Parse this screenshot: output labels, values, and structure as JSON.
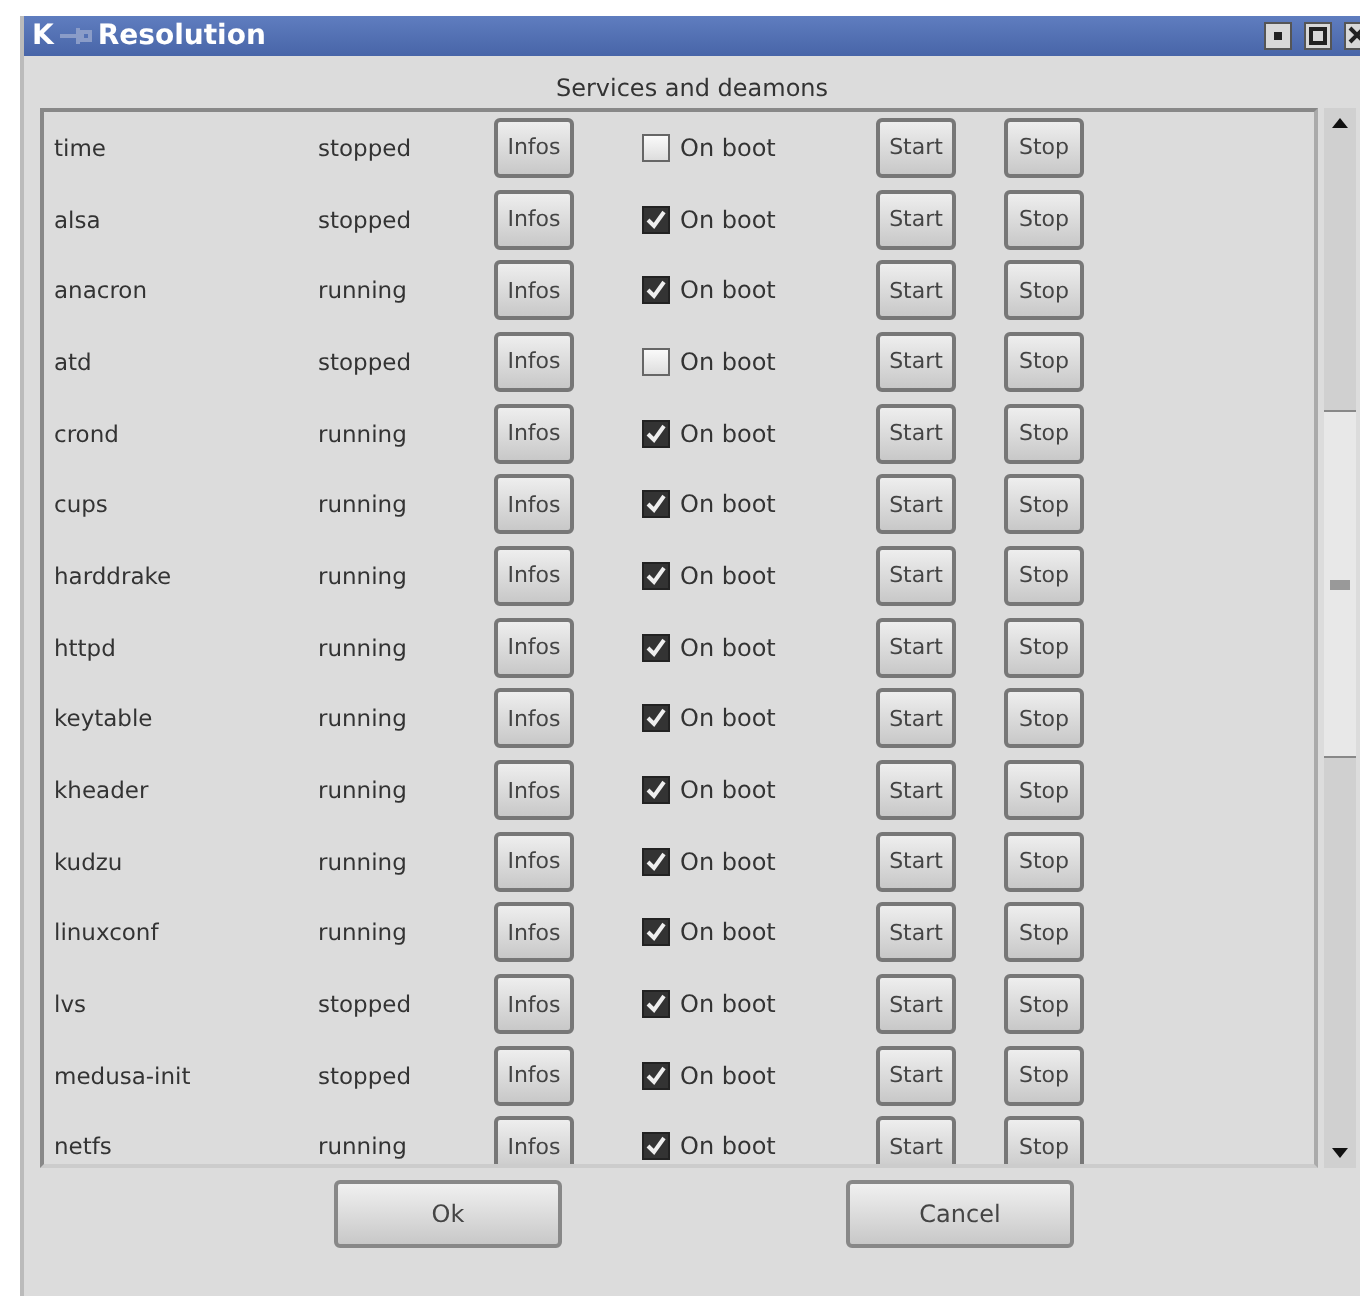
{
  "window": {
    "logo": "K",
    "title": "Resolution"
  },
  "heading": "Services and deamons",
  "services": [
    {
      "name": "time",
      "status": "stopped",
      "info": "Infos",
      "on_boot": false,
      "boot_label": "On boot",
      "start": "Start",
      "stop": "Stop"
    },
    {
      "name": "alsa",
      "status": "stopped",
      "info": "Infos",
      "on_boot": true,
      "boot_label": "On boot",
      "start": "Start",
      "stop": "Stop"
    },
    {
      "name": "anacron",
      "status": "running",
      "info": "Infos",
      "on_boot": true,
      "boot_label": "On boot",
      "start": "Start",
      "stop": "Stop"
    },
    {
      "name": "atd",
      "status": "stopped",
      "info": "Infos",
      "on_boot": false,
      "boot_label": "On boot",
      "start": "Start",
      "stop": "Stop"
    },
    {
      "name": "crond",
      "status": "running",
      "info": "Infos",
      "on_boot": true,
      "boot_label": "On boot",
      "start": "Start",
      "stop": "Stop"
    },
    {
      "name": "cups",
      "status": "running",
      "info": "Infos",
      "on_boot": true,
      "boot_label": "On boot",
      "start": "Start",
      "stop": "Stop"
    },
    {
      "name": "harddrake",
      "status": "running",
      "info": "Infos",
      "on_boot": true,
      "boot_label": "On boot",
      "start": "Start",
      "stop": "Stop"
    },
    {
      "name": "httpd",
      "status": "running",
      "info": "Infos",
      "on_boot": true,
      "boot_label": "On boot",
      "start": "Start",
      "stop": "Stop"
    },
    {
      "name": "keytable",
      "status": "running",
      "info": "Infos",
      "on_boot": true,
      "boot_label": "On boot",
      "start": "Start",
      "stop": "Stop"
    },
    {
      "name": "kheader",
      "status": "running",
      "info": "Infos",
      "on_boot": true,
      "boot_label": "On boot",
      "start": "Start",
      "stop": "Stop"
    },
    {
      "name": "kudzu",
      "status": "running",
      "info": "Infos",
      "on_boot": true,
      "boot_label": "On boot",
      "start": "Start",
      "stop": "Stop"
    },
    {
      "name": "linuxconf",
      "status": "running",
      "info": "Infos",
      "on_boot": true,
      "boot_label": "On boot",
      "start": "Start",
      "stop": "Stop"
    },
    {
      "name": "lvs",
      "status": "stopped",
      "info": "Infos",
      "on_boot": true,
      "boot_label": "On boot",
      "start": "Start",
      "stop": "Stop"
    },
    {
      "name": "medusa-init",
      "status": "stopped",
      "info": "Infos",
      "on_boot": true,
      "boot_label": "On boot",
      "start": "Start",
      "stop": "Stop"
    },
    {
      "name": "netfs",
      "status": "running",
      "info": "Infos",
      "on_boot": true,
      "boot_label": "On boot",
      "start": "Start",
      "stop": "Stop"
    }
  ],
  "buttons": [
    "Ok",
    "Cancel"
  ]
}
